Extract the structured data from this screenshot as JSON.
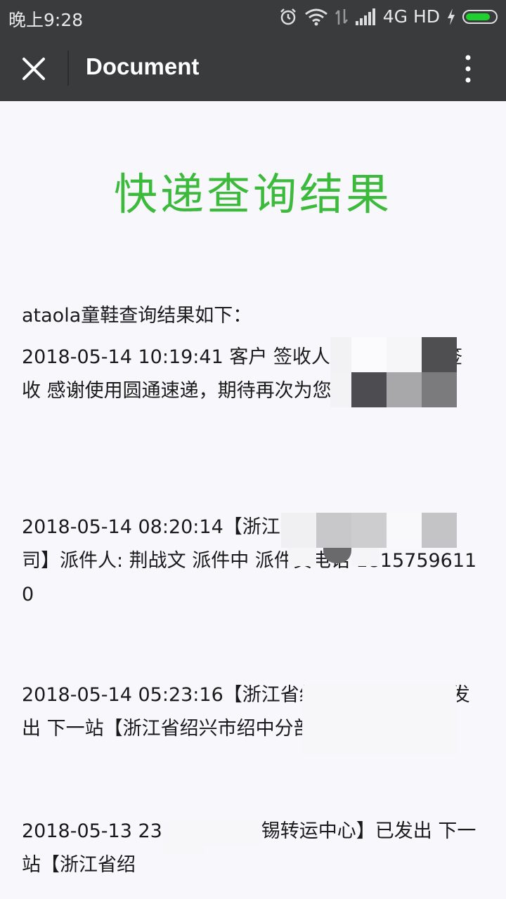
{
  "status_bar": {
    "time": "晚上9:28",
    "network": "4G HD",
    "icons": [
      "alarm-icon",
      "wifi-icon",
      "data-arrows-icon",
      "signal-icon",
      "charging-icon",
      "battery-icon"
    ]
  },
  "toolbar": {
    "title": "Document",
    "close_icon": "close-icon",
    "menu_icon": "more-vertical-icon"
  },
  "page": {
    "heading": "快递查询结果",
    "heading_color": "#3cba3c",
    "intro": "ataola童鞋查询结果如下：",
    "entries": [
      {
        "text": "2018-05-14 10:19:41 客户 签收人: 楼代理点 已签收 感谢使用圆通速递，期待再次为您服务"
      },
      {
        "text": "2018-05-14 08:20:14【浙江省绍兴市绍中分部公司】派件人: 荆战文 派件中 派件员电话 18157596110"
      },
      {
        "text": "2018-05-14 05:23:16【浙江省绍兴转运中心】已发出 下一站【浙江省绍兴市绍中分部公司】"
      },
      {
        "text": "2018-05-13 23:28:30【无锡转运中心】已发出 下一站【浙江省绍"
      }
    ]
  }
}
